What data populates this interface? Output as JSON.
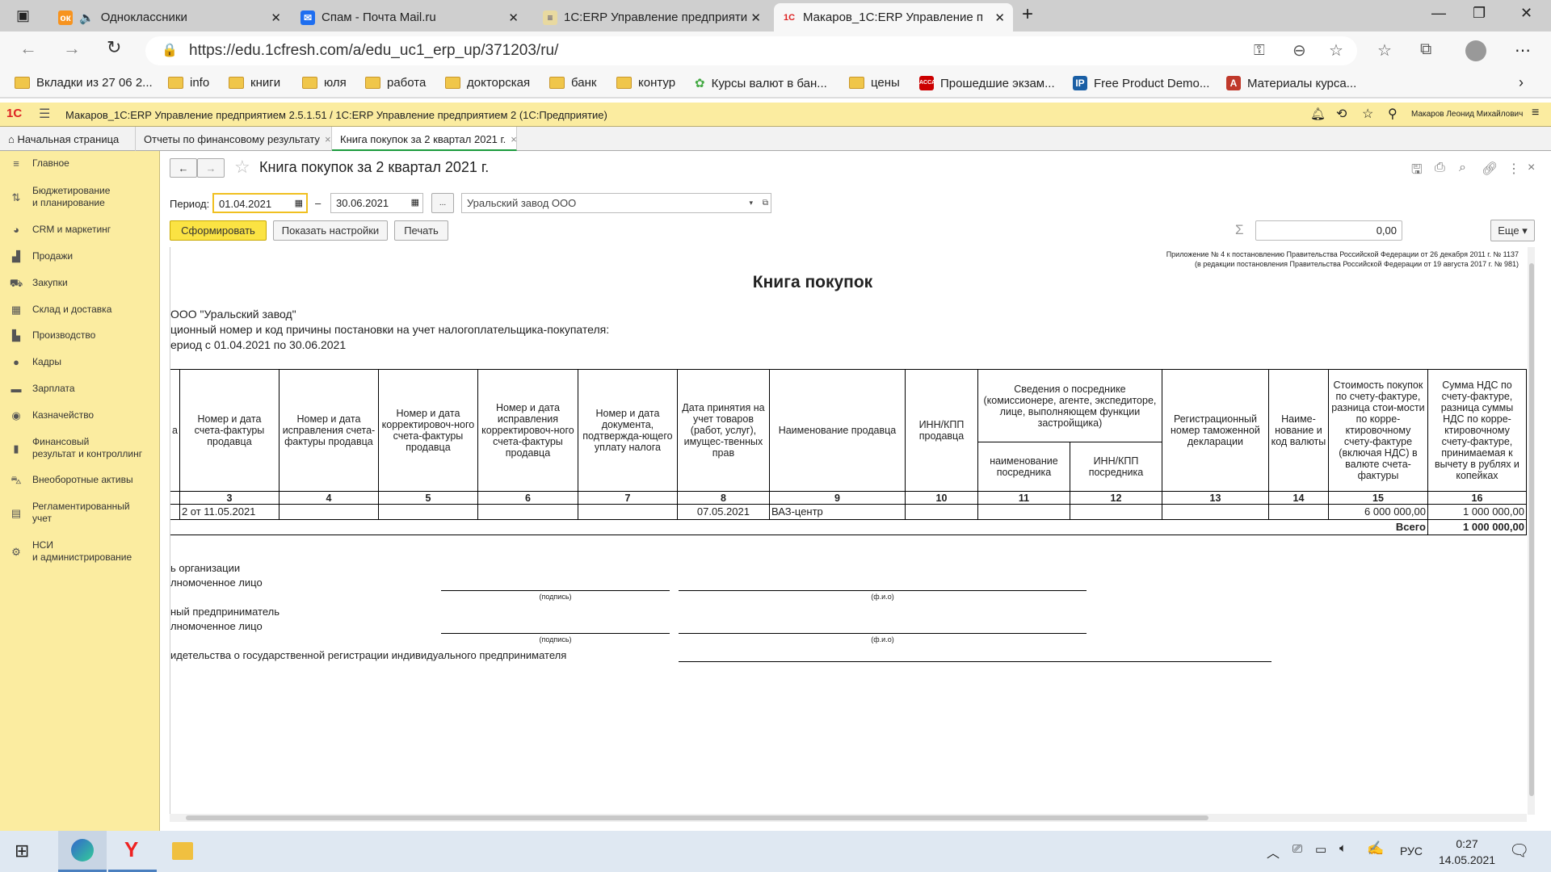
{
  "browser": {
    "tabs": [
      {
        "title": "Одноклассники",
        "icon": "odnoklassniki-icon"
      },
      {
        "title": "Спам - Почта Mail.ru",
        "icon": "mail-icon"
      },
      {
        "title": "1С:ERP Управление предприяти",
        "icon": "1c-icon"
      },
      {
        "title": "Макаров_1С:ERP Управление п",
        "icon": "1c-icon",
        "active": true
      }
    ],
    "url": "https://edu.1cfresh.com/a/edu_uc1_erp_up/371203/ru/",
    "bookmarks": [
      "Вкладки из 27 06 2...",
      "info",
      "книги",
      "юля",
      "работа",
      "докторская",
      "банк",
      "контур",
      "Курсы валют в бан...",
      "цены",
      "Прошедшие экзам...",
      "Free Product Demo...",
      "Материалы курса..."
    ]
  },
  "app": {
    "title": "Макаров_1С:ERP Управление предприятием 2.5.1.51 / 1С:ERP Управление предприятием 2  (1С:Предприятие)",
    "user": "Макаров Леонид Михайлович",
    "accent": "#fbeca0",
    "tabs": [
      "Начальная страница",
      "Отчеты по финансовому результату",
      "Книга покупок за 2 квартал 2021 г."
    ]
  },
  "sidebar": {
    "items": [
      "Главное",
      "Бюджетирование\nи планирование",
      "CRM и маркетинг",
      "Продажи",
      "Закупки",
      "Склад и доставка",
      "Производство",
      "Кадры",
      "Зарплата",
      "Казначейство",
      "Финансовый\nрезультат и контроллинг",
      "Внеоборотные активы",
      "Регламентированный\nучет",
      "НСИ\nи администрирование"
    ]
  },
  "form": {
    "title": "Книга покупок за 2 квартал 2021 г.",
    "period_label": "Период:",
    "date_from": "01.04.2021",
    "date_to": "30.06.2021",
    "dash": "–",
    "ellipsis": "...",
    "organization": "Уральский завод ООО",
    "generate": "Сформировать",
    "show_settings": "Показать настройки",
    "print": "Печать",
    "sum": "0,00",
    "more": "Еще"
  },
  "report": {
    "appendix1": "Приложение № 4 к постановлению Правительства Российской Федерации от 26 декабря 2011 г. № 1137",
    "appendix2": "(в редакции постановления Правительства Российской Федерации от 19 августа 2017 г. № 981)",
    "title": "Книга покупок",
    "buyer": "ООО \"Уральский завод\"",
    "inn_line": "ционный номер и код причины постановки на учет налогоплательщика-покупателя:",
    "period_line": "ериод с 01.04.2021 по 30.06.2021",
    "headers": {
      "c2": "а",
      "c3": "Номер и дата счета-фактуры продавца",
      "c4": "Номер и дата исправления счета-фактуры продавца",
      "c5": "Номер и дата корректировоч-ного счета-фактуры продавца",
      "c6": "Номер и дата исправления корректировоч-ного счета-фактуры продавца",
      "c7": "Номер и дата документа, подтвержда-ющего уплату налога",
      "c8": "Дата принятия на учет товаров (работ, услуг), имущес-твенных прав",
      "c9": "Наименование продавца",
      "c10": "ИНН/КПП продавца",
      "c11_12": "Сведения о посреднике (комиссионере, агенте, экспедиторе, лице, выполняющем функции застройщика)",
      "c11": "наименование посредника",
      "c12": "ИНН/КПП посредника",
      "c13": "Регистрационный номер таможенной декларации",
      "c14": "Наиме-нование и код валюты",
      "c15": "Стоимость покупок по счету-фактуре, разница стои-мости по корре-ктировочному счету-фактуре (включая НДС) в валюте счета-фактуры",
      "c16": "Сумма НДС по счету-фактуре, разница суммы НДС по корре-ктировочному счету-фактуре, принимаемая к вычету в рублях и копейках"
    },
    "numbers": [
      "3",
      "4",
      "5",
      "6",
      "7",
      "8",
      "9",
      "10",
      "11",
      "12",
      "13",
      "14",
      "15",
      "16"
    ],
    "row": {
      "c3": "2 от 11.05.2021",
      "c8": "07.05.2021",
      "c9": "ВАЗ-центр",
      "c15": "6 000 000,00",
      "c16": "1 000 000,00"
    },
    "total_label": "Всего",
    "total": "1 000 000,00",
    "footer": {
      "l1": "ь организации",
      "l2": "лномоченное лицо",
      "l3": "ный предприниматель",
      "l4": "лномоченное лицо",
      "l5": "идетельства о государственной регистрации индивидуального предпринимателя",
      "sign": "(подпись)",
      "fio": "(ф.и.о)"
    }
  },
  "taskbar": {
    "lang": "РУС",
    "time": "0:27",
    "date": "14.05.2021"
  }
}
